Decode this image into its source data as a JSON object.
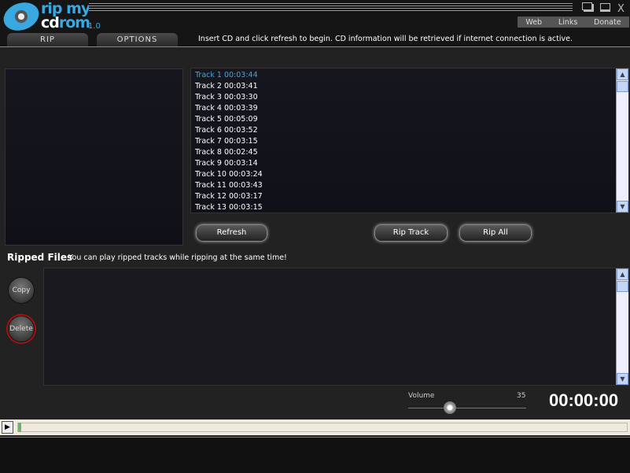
{
  "app": {
    "logo_top": "rip my",
    "logo_bottom_1": "cd",
    "logo_bottom_2": "rom",
    "version": "1.0"
  },
  "window": {
    "close": "X"
  },
  "tabs": [
    {
      "label": "RIP"
    },
    {
      "label": "OPTIONS"
    }
  ],
  "info_text": "Insert CD and click refresh to begin.  CD information will be retrieved if internet connection is active.",
  "links": [
    "Web",
    "Links",
    "Donate"
  ],
  "tracks": [
    "Track 1 00:03:44",
    "Track 2 00:03:41",
    "Track 3 00:03:30",
    "Track 4 00:03:39",
    "Track 5 00:05:09",
    "Track 6 00:03:52",
    "Track 7 00:03:15",
    "Track 8 00:02:45",
    "Track 9 00:03:14",
    "Track 10 00:03:24",
    "Track 11 00:03:43",
    "Track 12 00:03:17",
    "Track 13 00:03:15"
  ],
  "selected_track_color": "#3aa8e0",
  "buttons": {
    "refresh": "Refresh",
    "rip_track": "Rip Track",
    "rip_all": "Rip All",
    "copy": "Copy",
    "delete": "Delete"
  },
  "ripped": {
    "title": "Ripped Files",
    "hint": "You can play ripped tracks while ripping at the same time!"
  },
  "volume": {
    "label": "Volume",
    "value": "35",
    "level": 35
  },
  "time": "00:00:00",
  "progress": 0
}
